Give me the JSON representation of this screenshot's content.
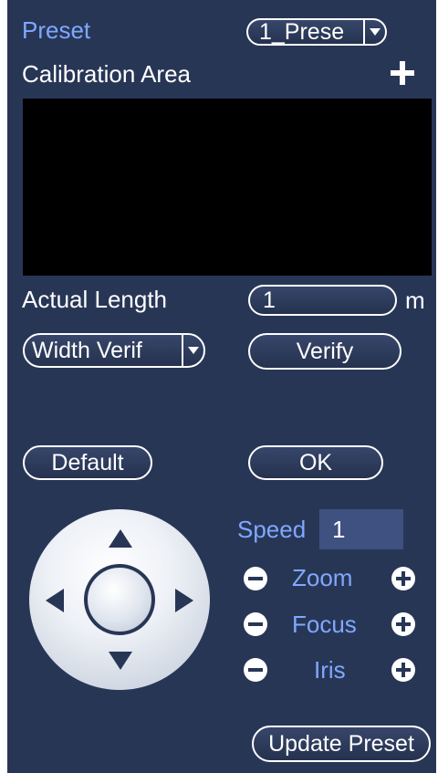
{
  "preset": {
    "label": "Preset",
    "selected": "1_Prese"
  },
  "calibration": {
    "label": "Calibration Area",
    "add_icon": "plus-icon"
  },
  "actual_length": {
    "label": "Actual Length",
    "value": "1",
    "unit": "m"
  },
  "verify_mode": {
    "selected": "Width Verif"
  },
  "buttons": {
    "verify": "Verify",
    "default": "Default",
    "ok": "OK",
    "update_preset": "Update Preset"
  },
  "speed": {
    "label": "Speed",
    "value": "1"
  },
  "controls": {
    "zoom": "Zoom",
    "focus": "Focus",
    "iris": "Iris"
  },
  "colors": {
    "panel_bg": "#283656",
    "preset_label": "#7fa8ff",
    "calibration_area": "#000000",
    "speed_box": "#3e5180"
  }
}
